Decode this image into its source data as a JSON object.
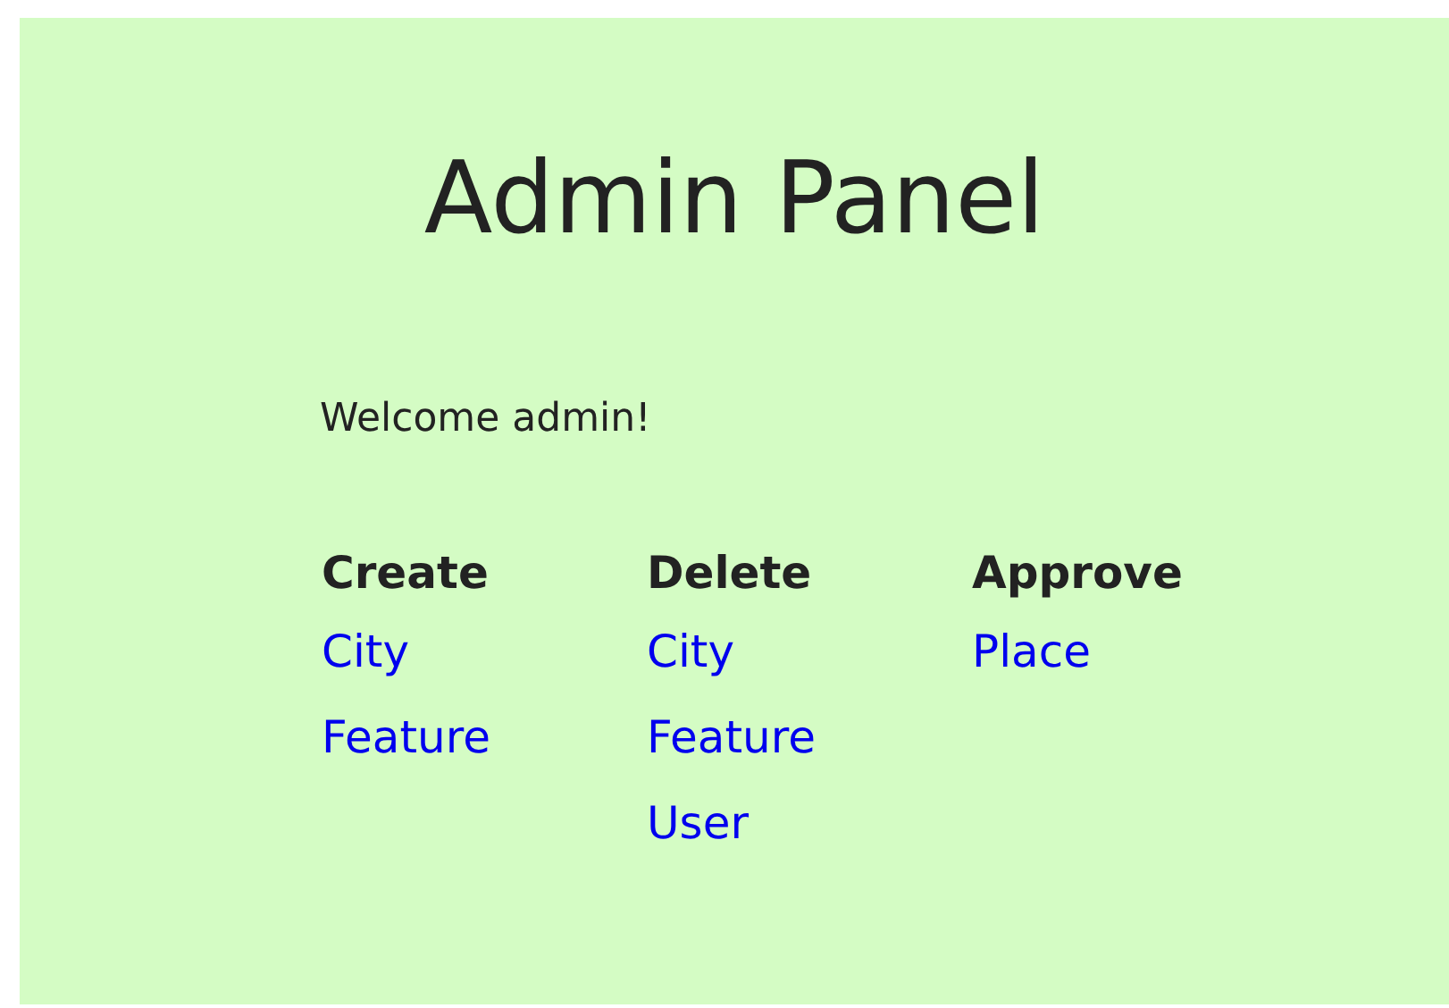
{
  "title": "Admin Panel",
  "welcome": "Welcome admin!",
  "sections": [
    {
      "heading": "Create",
      "links": [
        "City",
        "Feature"
      ]
    },
    {
      "heading": "Delete",
      "links": [
        "City",
        "Feature",
        "User"
      ]
    },
    {
      "heading": "Approve",
      "links": [
        "Place"
      ]
    }
  ]
}
